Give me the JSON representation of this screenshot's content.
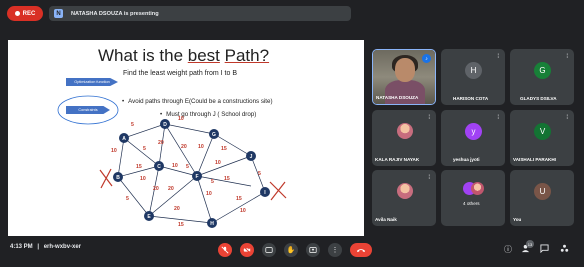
{
  "recording": {
    "label": "REC"
  },
  "presenter_bar": {
    "initial": "N",
    "text": "NATASHA DSOUZA is presenting"
  },
  "slide": {
    "title_pre": "What is the ",
    "title_best": "best",
    "title_path": "Path?",
    "subtitle": "Find the least weight path from I to B",
    "chips": [
      "Optimization function",
      "Constraints"
    ],
    "bullets": [
      "Avoid paths through E(Could be a constructions site)",
      "Must go through J ( School drop)"
    ],
    "nodes": [
      "A",
      "B",
      "C",
      "D",
      "E",
      "F",
      "G",
      "H",
      "I",
      "J"
    ],
    "edge_weights": [
      "5",
      "10",
      "10",
      "20",
      "5",
      "20",
      "10",
      "15",
      "15",
      "10",
      "5",
      "10",
      "15",
      "5",
      "10",
      "20",
      "20",
      "5",
      "10",
      "15",
      "20",
      "10",
      "5",
      "15"
    ]
  },
  "participants": [
    {
      "name": "NATASHA DSOUZA",
      "type": "video",
      "active": true
    },
    {
      "name": "HARISON COTA",
      "initial": "H",
      "color": "#5f6368"
    },
    {
      "name": "GLADYS DSILVA",
      "initial": "G",
      "color": "#188038"
    },
    {
      "name": "KALA RAJIV NAYAK",
      "type": "photo"
    },
    {
      "name": "yeshua jyoti",
      "initial": "y",
      "color": "#a142f4"
    },
    {
      "name": "VAISHALI PARAKHI",
      "initial": "V",
      "color": "#137333"
    },
    {
      "name": "Avila Naik",
      "type": "photo"
    },
    {
      "name": "4 others",
      "type": "others"
    },
    {
      "name": "You",
      "initial": "U",
      "color": "#795548"
    }
  ],
  "bottom": {
    "time": "4:13 PM",
    "separator": "|",
    "meeting_code": "erh-wxbv-xer",
    "people_count": "13"
  },
  "icons": {
    "mic_off": "mic-off-icon",
    "cam_off": "camera-off-icon",
    "captions": "captions-icon",
    "hand": "raise-hand-icon",
    "present": "present-icon",
    "more": "more-icon",
    "hangup": "hangup-icon"
  }
}
